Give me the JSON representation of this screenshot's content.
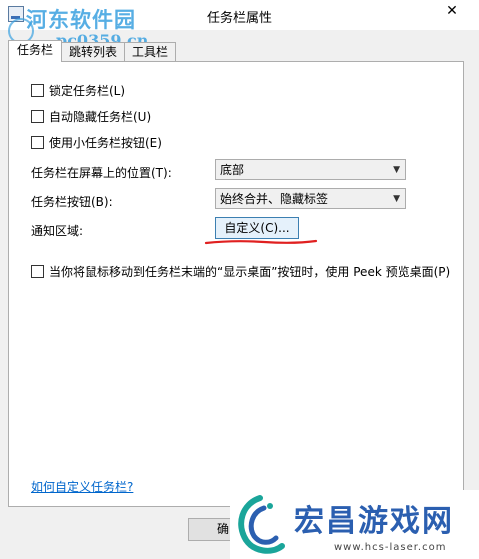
{
  "window": {
    "title": "任务栏属性",
    "close_glyph": "✕"
  },
  "watermark": {
    "line1": "河东软件园",
    "line2": "pc0359.cn"
  },
  "tabs": [
    {
      "label": "任务栏"
    },
    {
      "label": "跳转列表"
    },
    {
      "label": "工具栏"
    }
  ],
  "options": {
    "lock": "锁定任务栏(L)",
    "autohide": "自动隐藏任务栏(U)",
    "small": "使用小任务栏按钮(E)",
    "peek": "当你将鼠标移动到任务栏末端的“显示桌面”按钮时，使用 Peek 预览桌面(P)"
  },
  "settings": {
    "position_label": "任务栏在屏幕上的位置(T):",
    "position_value": "底部",
    "buttons_label": "任务栏按钮(B):",
    "buttons_value": "始终合并、隐藏标签",
    "notify_label": "通知区域:",
    "customize_button": "自定义(C)..."
  },
  "link": "如何自定义任务栏?",
  "footer": {
    "ok_button": "确"
  },
  "badge": {
    "title": "宏昌游戏网",
    "url": "www.hcs-laser.com"
  },
  "colors": {
    "link": "#0066cc",
    "annotation": "#e02020",
    "badge_text": "#2b5fb0"
  }
}
